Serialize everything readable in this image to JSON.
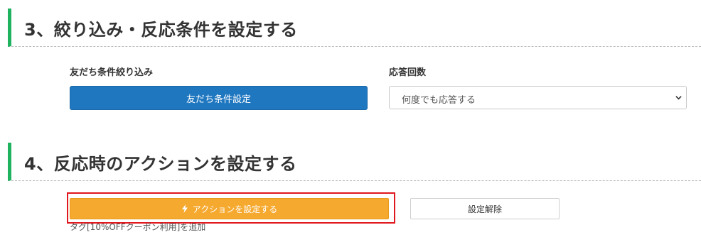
{
  "sections": [
    {
      "heading": "3、絞り込み・反応条件を設定する"
    },
    {
      "heading": "4、反応時のアクションを設定する"
    }
  ],
  "filter": {
    "label": "友だち条件絞り込み",
    "button_label": "友だち条件設定"
  },
  "response": {
    "label": "応答回数",
    "selected": "何度でも応答する"
  },
  "action": {
    "button_label": "アクションを設定する",
    "button_icon": "lightning-icon",
    "clear_label": "設定解除",
    "summary": "タグ[10%OFFクーポン利用]を追加"
  },
  "colors": {
    "heading_accent": "#1fb35f",
    "primary_button": "#1f77c0",
    "action_button": "#f6a92f",
    "highlight_frame": "#e0171e"
  }
}
